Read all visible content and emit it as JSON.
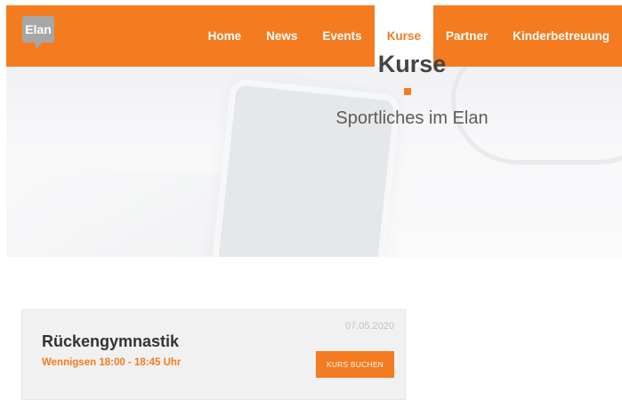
{
  "header": {
    "logo_text": "Elan",
    "nav": [
      {
        "label": "Home"
      },
      {
        "label": "News"
      },
      {
        "label": "Events"
      },
      {
        "label": "Kurse",
        "active": true
      },
      {
        "label": "Partner"
      },
      {
        "label": "Kinderbetreuung"
      }
    ],
    "colors": {
      "brand": "#f47b20",
      "logo": "#a7a7a7"
    }
  },
  "hero": {
    "title": "Kurse",
    "subtitle": "Sportliches im Elan"
  },
  "courses": [
    {
      "date": "07.05.2020",
      "title": "Rückengymnastik",
      "subtitle": "Wennigsen 18:00 - 18:45 Uhr",
      "button_label": "KURS BUCHEN"
    }
  ]
}
